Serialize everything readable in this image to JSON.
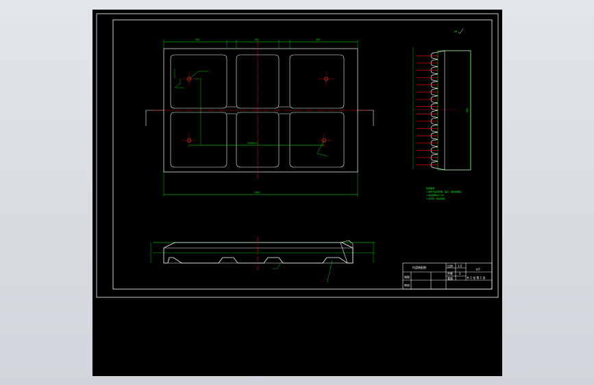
{
  "title_block": {
    "drawing_name": "托盘装配图",
    "scale_label": "比例",
    "scale_value": "1:5",
    "count_label": "件数",
    "count_value": "1",
    "material_value": "HT",
    "drawn_label": "制图",
    "checked_label": "审核",
    "weight_label": "重量",
    "sheet_text": "共 1 张  第 1 张"
  },
  "dimensions": {
    "overall_width": "1450",
    "hole_spacing": "1000±0.1",
    "height_right": "900",
    "top_seg_1": "540",
    "top_seg_2": "120",
    "top_seg_3": "430"
  },
  "notes": {
    "heading": "技术要求",
    "line1": "1.铸件不得有砂眼、缩孔、裂纹等缺陷。",
    "line2": "2.未注圆角R3~R5。",
    "line3": "3.去毛刺，锐边倒钝。"
  },
  "roughness_mark": "Ra",
  "colors": {
    "sheet": "#000000",
    "outline": "#ffffff",
    "dimension": "#00ff00",
    "centerline": "#ff0000"
  }
}
